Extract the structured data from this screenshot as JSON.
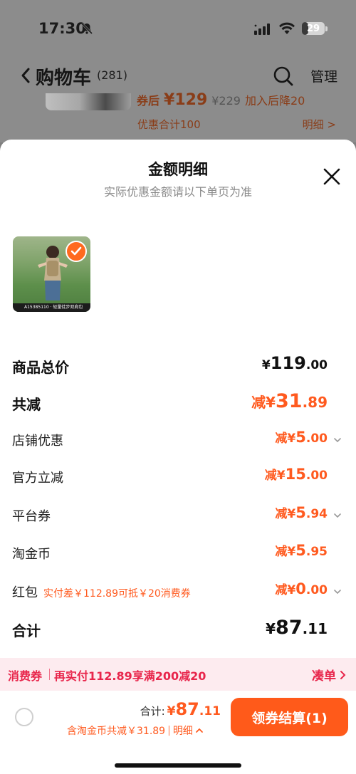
{
  "status_bar": {
    "time": "17:30",
    "battery": "29",
    "battery_level": 0.29,
    "icons": [
      "bell-muted-icon",
      "signal-icon",
      "wifi-icon",
      "battery-icon"
    ]
  },
  "cart_header": {
    "title": "购物车",
    "count": "(281)",
    "manage": "管理"
  },
  "peek_item": {
    "after_coupon": "券后",
    "price": "¥129",
    "original_price": "¥229",
    "drop_note": "加入后降20",
    "discount_total": "优惠合计100",
    "detail_link": "明细 >"
  },
  "sheet": {
    "title": "金额明细",
    "subtitle": "实际优惠金额请以下单页为准",
    "product_caption": "A15385110 · 轻量徒步双肩包"
  },
  "rows": {
    "goods_total": {
      "label": "商品总价",
      "prefix": "¥",
      "int": "119",
      "dec": ".00"
    },
    "total_reduce": {
      "label": "共减",
      "prefix": "减¥",
      "int": "31",
      "dec": ".89"
    },
    "shop_discount": {
      "label": "店铺优惠",
      "prefix": "减¥",
      "int": "5",
      "dec": ".00"
    },
    "official_reduce": {
      "label": "官方立减",
      "prefix": "减¥",
      "int": "15",
      "dec": ".00"
    },
    "platform_coupon": {
      "label": "平台券",
      "prefix": "减¥",
      "int": "5",
      "dec": ".94"
    },
    "taojinbi": {
      "label": "淘金币",
      "prefix": "减¥",
      "int": "5",
      "dec": ".95"
    },
    "red_packet": {
      "label": "红包",
      "note": "实付差￥112.89可抵￥20消费券",
      "prefix": "减¥",
      "int": "0",
      "dec": ".00"
    },
    "sum": {
      "label": "合计",
      "prefix": "¥",
      "int": "87",
      "dec": ".11"
    }
  },
  "coupon_bar": {
    "tag": "消费券",
    "text": "再实付112.89享满200减20",
    "action": "凑单"
  },
  "footer": {
    "total_label": "合计:",
    "total_prefix": "¥",
    "total_int": "87",
    "total_dec": ".11",
    "savings": "含淘金币共减￥31.89",
    "detail": "明细",
    "checkout": "领券结算(1)"
  },
  "colors": {
    "accent": "#ff5a1f",
    "coupon_red": "#e8254b",
    "coupon_bg": "#fdebef"
  }
}
